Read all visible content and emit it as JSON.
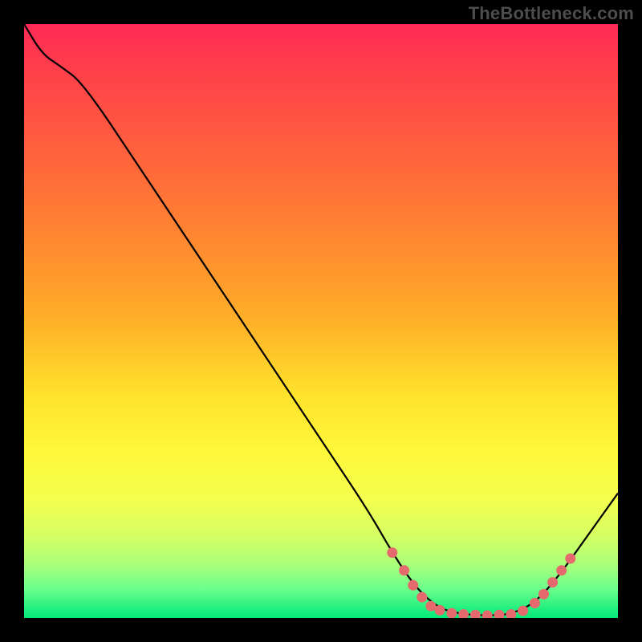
{
  "attribution": "TheBottleneck.com",
  "colors": {
    "page_bg": "#000000",
    "attribution_text": "#4d4d4d",
    "curve_stroke": "#000000",
    "marker_fill": "#e46a6d",
    "marker_stroke": "#b84d50",
    "gradient_stops": [
      {
        "offset": 0.0,
        "color": "#ff2a55"
      },
      {
        "offset": 0.12,
        "color": "#ff4a46"
      },
      {
        "offset": 0.25,
        "color": "#ff6a3a"
      },
      {
        "offset": 0.38,
        "color": "#ff8c2f"
      },
      {
        "offset": 0.5,
        "color": "#ffb028"
      },
      {
        "offset": 0.62,
        "color": "#ffe12b"
      },
      {
        "offset": 0.72,
        "color": "#fff83a"
      },
      {
        "offset": 0.8,
        "color": "#f4ff4e"
      },
      {
        "offset": 0.86,
        "color": "#d6ff63"
      },
      {
        "offset": 0.91,
        "color": "#aaff78"
      },
      {
        "offset": 0.95,
        "color": "#6eff8c"
      },
      {
        "offset": 1.0,
        "color": "#00e978"
      }
    ]
  },
  "chart_data": {
    "type": "line",
    "title": "",
    "xlabel": "",
    "ylabel": "",
    "xlim": [
      0,
      100
    ],
    "ylim": [
      0,
      100
    ],
    "curve": [
      {
        "x": 0,
        "y": 100
      },
      {
        "x": 3,
        "y": 95
      },
      {
        "x": 6,
        "y": 93
      },
      {
        "x": 10,
        "y": 90
      },
      {
        "x": 20,
        "y": 75
      },
      {
        "x": 30,
        "y": 60
      },
      {
        "x": 40,
        "y": 45
      },
      {
        "x": 50,
        "y": 30
      },
      {
        "x": 58,
        "y": 18
      },
      {
        "x": 62,
        "y": 11
      },
      {
        "x": 66,
        "y": 5
      },
      {
        "x": 70,
        "y": 1.5
      },
      {
        "x": 74,
        "y": 0.6
      },
      {
        "x": 78,
        "y": 0.4
      },
      {
        "x": 82,
        "y": 0.6
      },
      {
        "x": 86,
        "y": 2.5
      },
      {
        "x": 90,
        "y": 7
      },
      {
        "x": 95,
        "y": 14
      },
      {
        "x": 100,
        "y": 21
      }
    ],
    "markers": [
      {
        "x": 62.0,
        "y": 11.0
      },
      {
        "x": 64.0,
        "y": 8.0
      },
      {
        "x": 65.5,
        "y": 5.5
      },
      {
        "x": 67.0,
        "y": 3.5
      },
      {
        "x": 68.5,
        "y": 2.0
      },
      {
        "x": 70.0,
        "y": 1.3
      },
      {
        "x": 72.0,
        "y": 0.8
      },
      {
        "x": 74.0,
        "y": 0.6
      },
      {
        "x": 76.0,
        "y": 0.5
      },
      {
        "x": 78.0,
        "y": 0.4
      },
      {
        "x": 80.0,
        "y": 0.5
      },
      {
        "x": 82.0,
        "y": 0.6
      },
      {
        "x": 84.0,
        "y": 1.2
      },
      {
        "x": 86.0,
        "y": 2.5
      },
      {
        "x": 87.5,
        "y": 4.0
      },
      {
        "x": 89.0,
        "y": 6.0
      },
      {
        "x": 90.5,
        "y": 8.0
      },
      {
        "x": 92.0,
        "y": 10.0
      }
    ]
  }
}
